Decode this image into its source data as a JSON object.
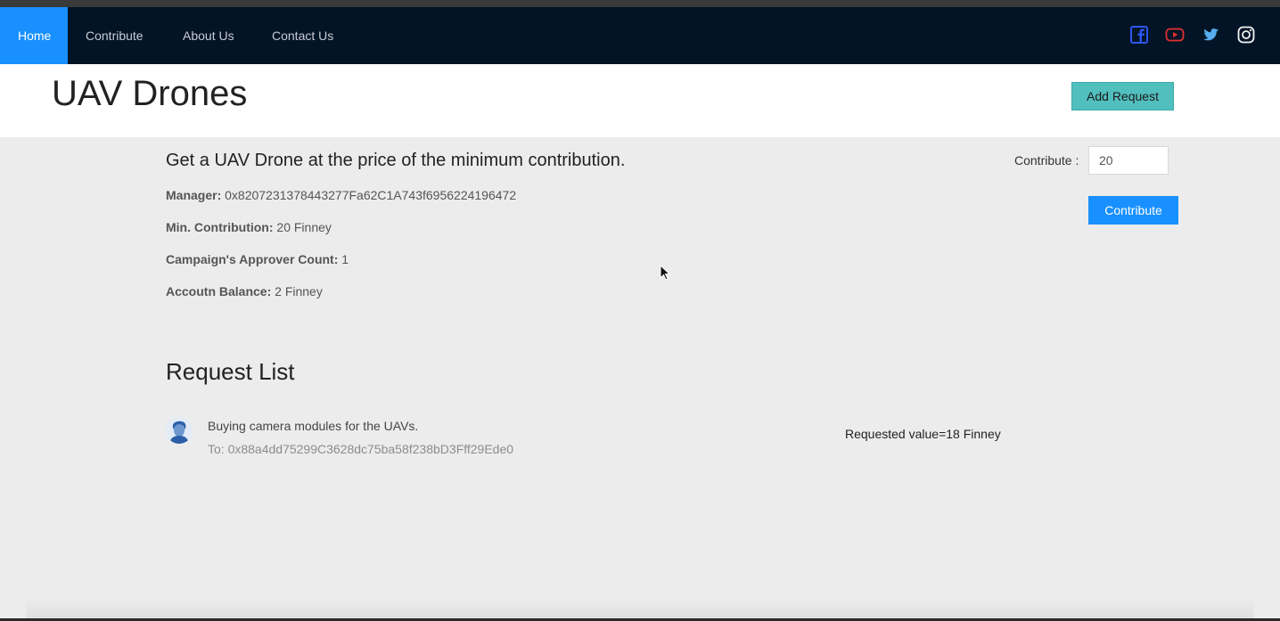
{
  "nav": {
    "items": [
      {
        "label": "Home",
        "active": true
      },
      {
        "label": "Contribute"
      },
      {
        "label": "About Us"
      },
      {
        "label": "Contact Us"
      }
    ],
    "social_icons": [
      "facebook-icon",
      "youtube-icon",
      "twitter-icon",
      "instagram-icon"
    ]
  },
  "header": {
    "title": "UAV Drones",
    "add_request_label": "Add Request"
  },
  "campaign": {
    "headline": "Get a UAV Drone at the price of the minimum contribution.",
    "manager_label": "Manager:",
    "manager_value": "0x8207231378443277Fa62C1A743f6956224196472",
    "min_contribution_label": "Min. Contribution:",
    "min_contribution_value": "20 Finney",
    "approver_count_label": "Campaign's Approver Count:",
    "approver_count_value": "1",
    "balance_label": "Accoutn Balance:",
    "balance_value": "2 Finney"
  },
  "contribute": {
    "label": "Contribute",
    "colon": ":",
    "input_value": "20",
    "button_label": "Contribute"
  },
  "requests": {
    "title": "Request List",
    "items": [
      {
        "title": "Buying camera modules for the UAVs.",
        "description": "To: 0x88a4dd75299C3628dc75ba58f238bD3Fff29Ede0",
        "value": "Requested value=18 Finney"
      }
    ]
  },
  "colors": {
    "nav_bg": "#031426",
    "accent": "#1890ff",
    "add_request_bg": "#52bfbf",
    "page_bg": "#ececec"
  }
}
